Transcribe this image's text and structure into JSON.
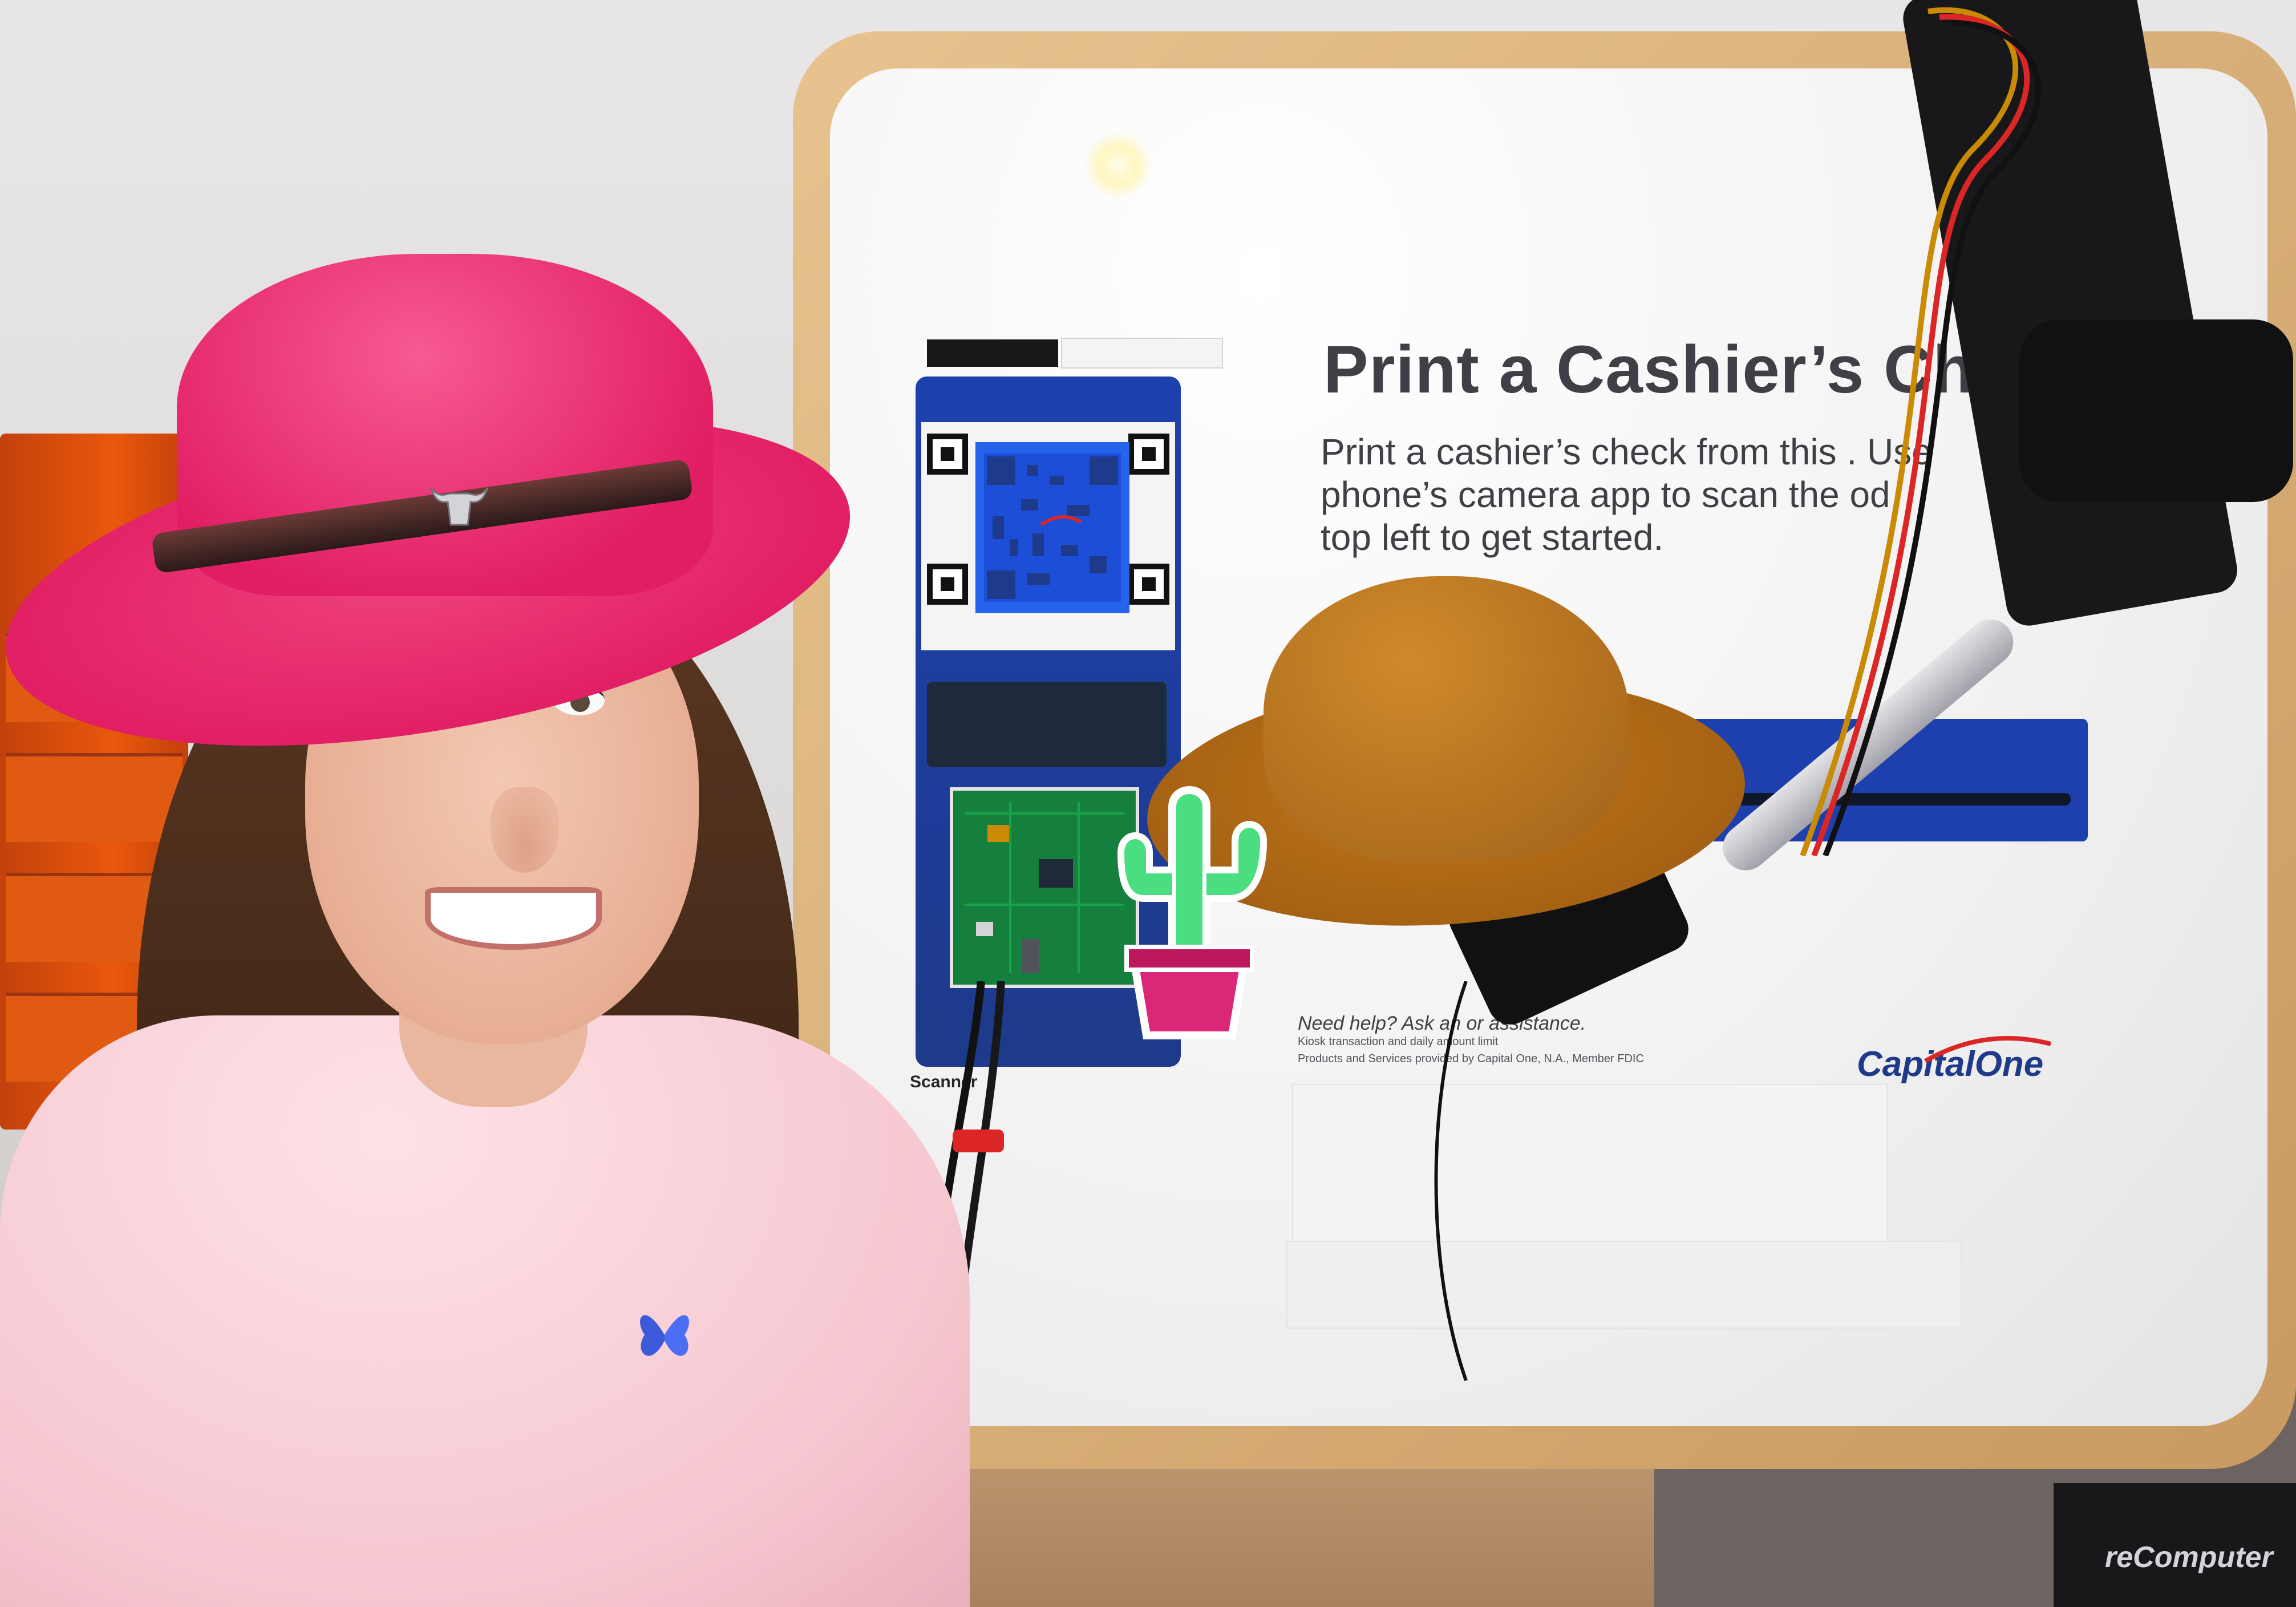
{
  "kiosk": {
    "title": "Print a Cashier’s Che",
    "body_lines": [
      "Print a cashier’s check from this     . Use",
      "phone’s camera app to scan the    od",
      "top left to get started."
    ],
    "help_text": "Need help? Ask an              or assistance.",
    "fine_print": [
      "Kiosk transaction and daily amount limit",
      "Products and Services provided by Capital One, N.A., Member FDIC"
    ],
    "scanner_label": "Scanner",
    "brand_name": "CapitalOne"
  },
  "device_label": "reComputer",
  "colors": {
    "pink_hat": "#e11d63",
    "kiosk_blue": "#1e40af",
    "small_hat": "#b8721c",
    "kiosk_frame": "#d6aa72",
    "cactus": "#22c55e",
    "pot": "#db2777"
  }
}
